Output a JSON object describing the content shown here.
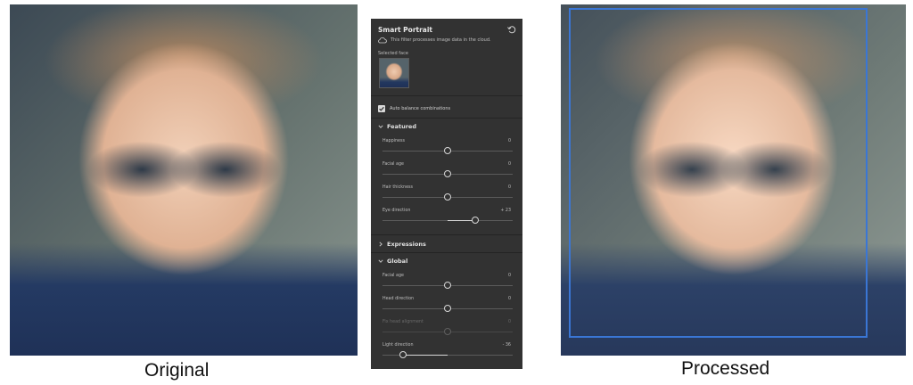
{
  "captions": {
    "original": "Original",
    "processed": "Processed"
  },
  "panel": {
    "title": "Smart Portrait",
    "cloud_note": "This filter processes image data in the cloud.",
    "selected_face_label": "Selected face",
    "auto_balance_label": "Auto balance combinations",
    "auto_balance_checked": true,
    "sections": {
      "featured": "Featured",
      "expressions": "Expressions",
      "global": "Global"
    },
    "featured_sliders": [
      {
        "label": "Happiness",
        "value": "0"
      },
      {
        "label": "Facial age",
        "value": "0"
      },
      {
        "label": "Hair thickness",
        "value": "0"
      },
      {
        "label": "Eye direction",
        "value": "+ 23"
      }
    ],
    "global_sliders": [
      {
        "label": "Facial age",
        "value": "0"
      },
      {
        "label": "Head direction",
        "value": "0"
      },
      {
        "label": "Fix head alignment",
        "value": "0"
      },
      {
        "label": "Light direction",
        "value": "- 36"
      }
    ]
  },
  "colors": {
    "panel_bg": "#323232",
    "face_box": "#2f6fd6"
  }
}
